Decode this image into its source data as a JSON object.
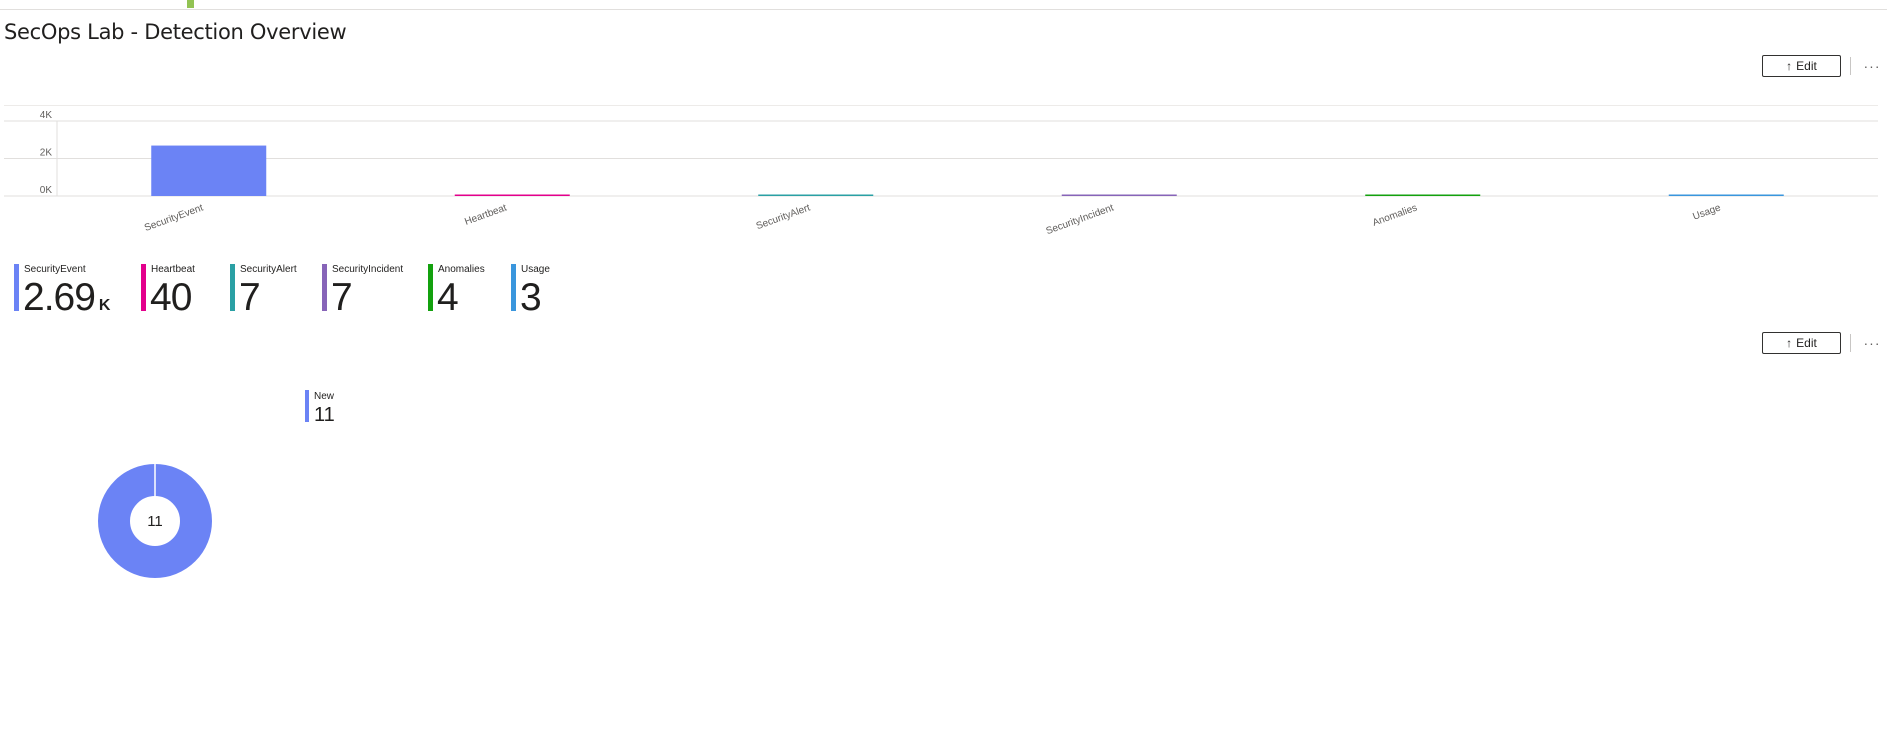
{
  "page": {
    "title": "SecOps Lab - Detection Overview"
  },
  "toolbar": {
    "edit_label": "Edit",
    "more_label": "···",
    "edit_icon": "↑"
  },
  "chart_data": [
    {
      "type": "bar",
      "categories": [
        "SecurityEvent",
        "Heartbeat",
        "SecurityAlert",
        "SecurityIncident",
        "Anomalies",
        "Usage"
      ],
      "values": [
        2690,
        40,
        7,
        7,
        4,
        3
      ],
      "colors": [
        "#6b83f5",
        "#e3008c",
        "#2aa0a4",
        "#8764b8",
        "#13a10e",
        "#3a96dd"
      ],
      "yticks": [
        "0K",
        "2K",
        "4K"
      ],
      "ytick_values": [
        0,
        2000,
        4000
      ],
      "ylim": [
        0,
        4000
      ],
      "grid": true
    },
    {
      "type": "pie",
      "categories": [
        "New"
      ],
      "values": [
        11
      ],
      "colors": [
        "#6b83f5"
      ],
      "center_label": "11"
    }
  ],
  "tiles": [
    {
      "label": "SecurityEvent",
      "value": "2.69",
      "unit": "K",
      "color": "#6b83f5"
    },
    {
      "label": "Heartbeat",
      "value": "40",
      "unit": "",
      "color": "#e3008c"
    },
    {
      "label": "SecurityAlert",
      "value": "7",
      "unit": "",
      "color": "#2aa0a4"
    },
    {
      "label": "SecurityIncident",
      "value": "7",
      "unit": "",
      "color": "#8764b8"
    },
    {
      "label": "Anomalies",
      "value": "4",
      "unit": "",
      "color": "#13a10e"
    },
    {
      "label": "Usage",
      "value": "3",
      "unit": "",
      "color": "#3a96dd"
    }
  ],
  "status_legend": {
    "label": "New",
    "value": "11",
    "color": "#6b83f5"
  }
}
